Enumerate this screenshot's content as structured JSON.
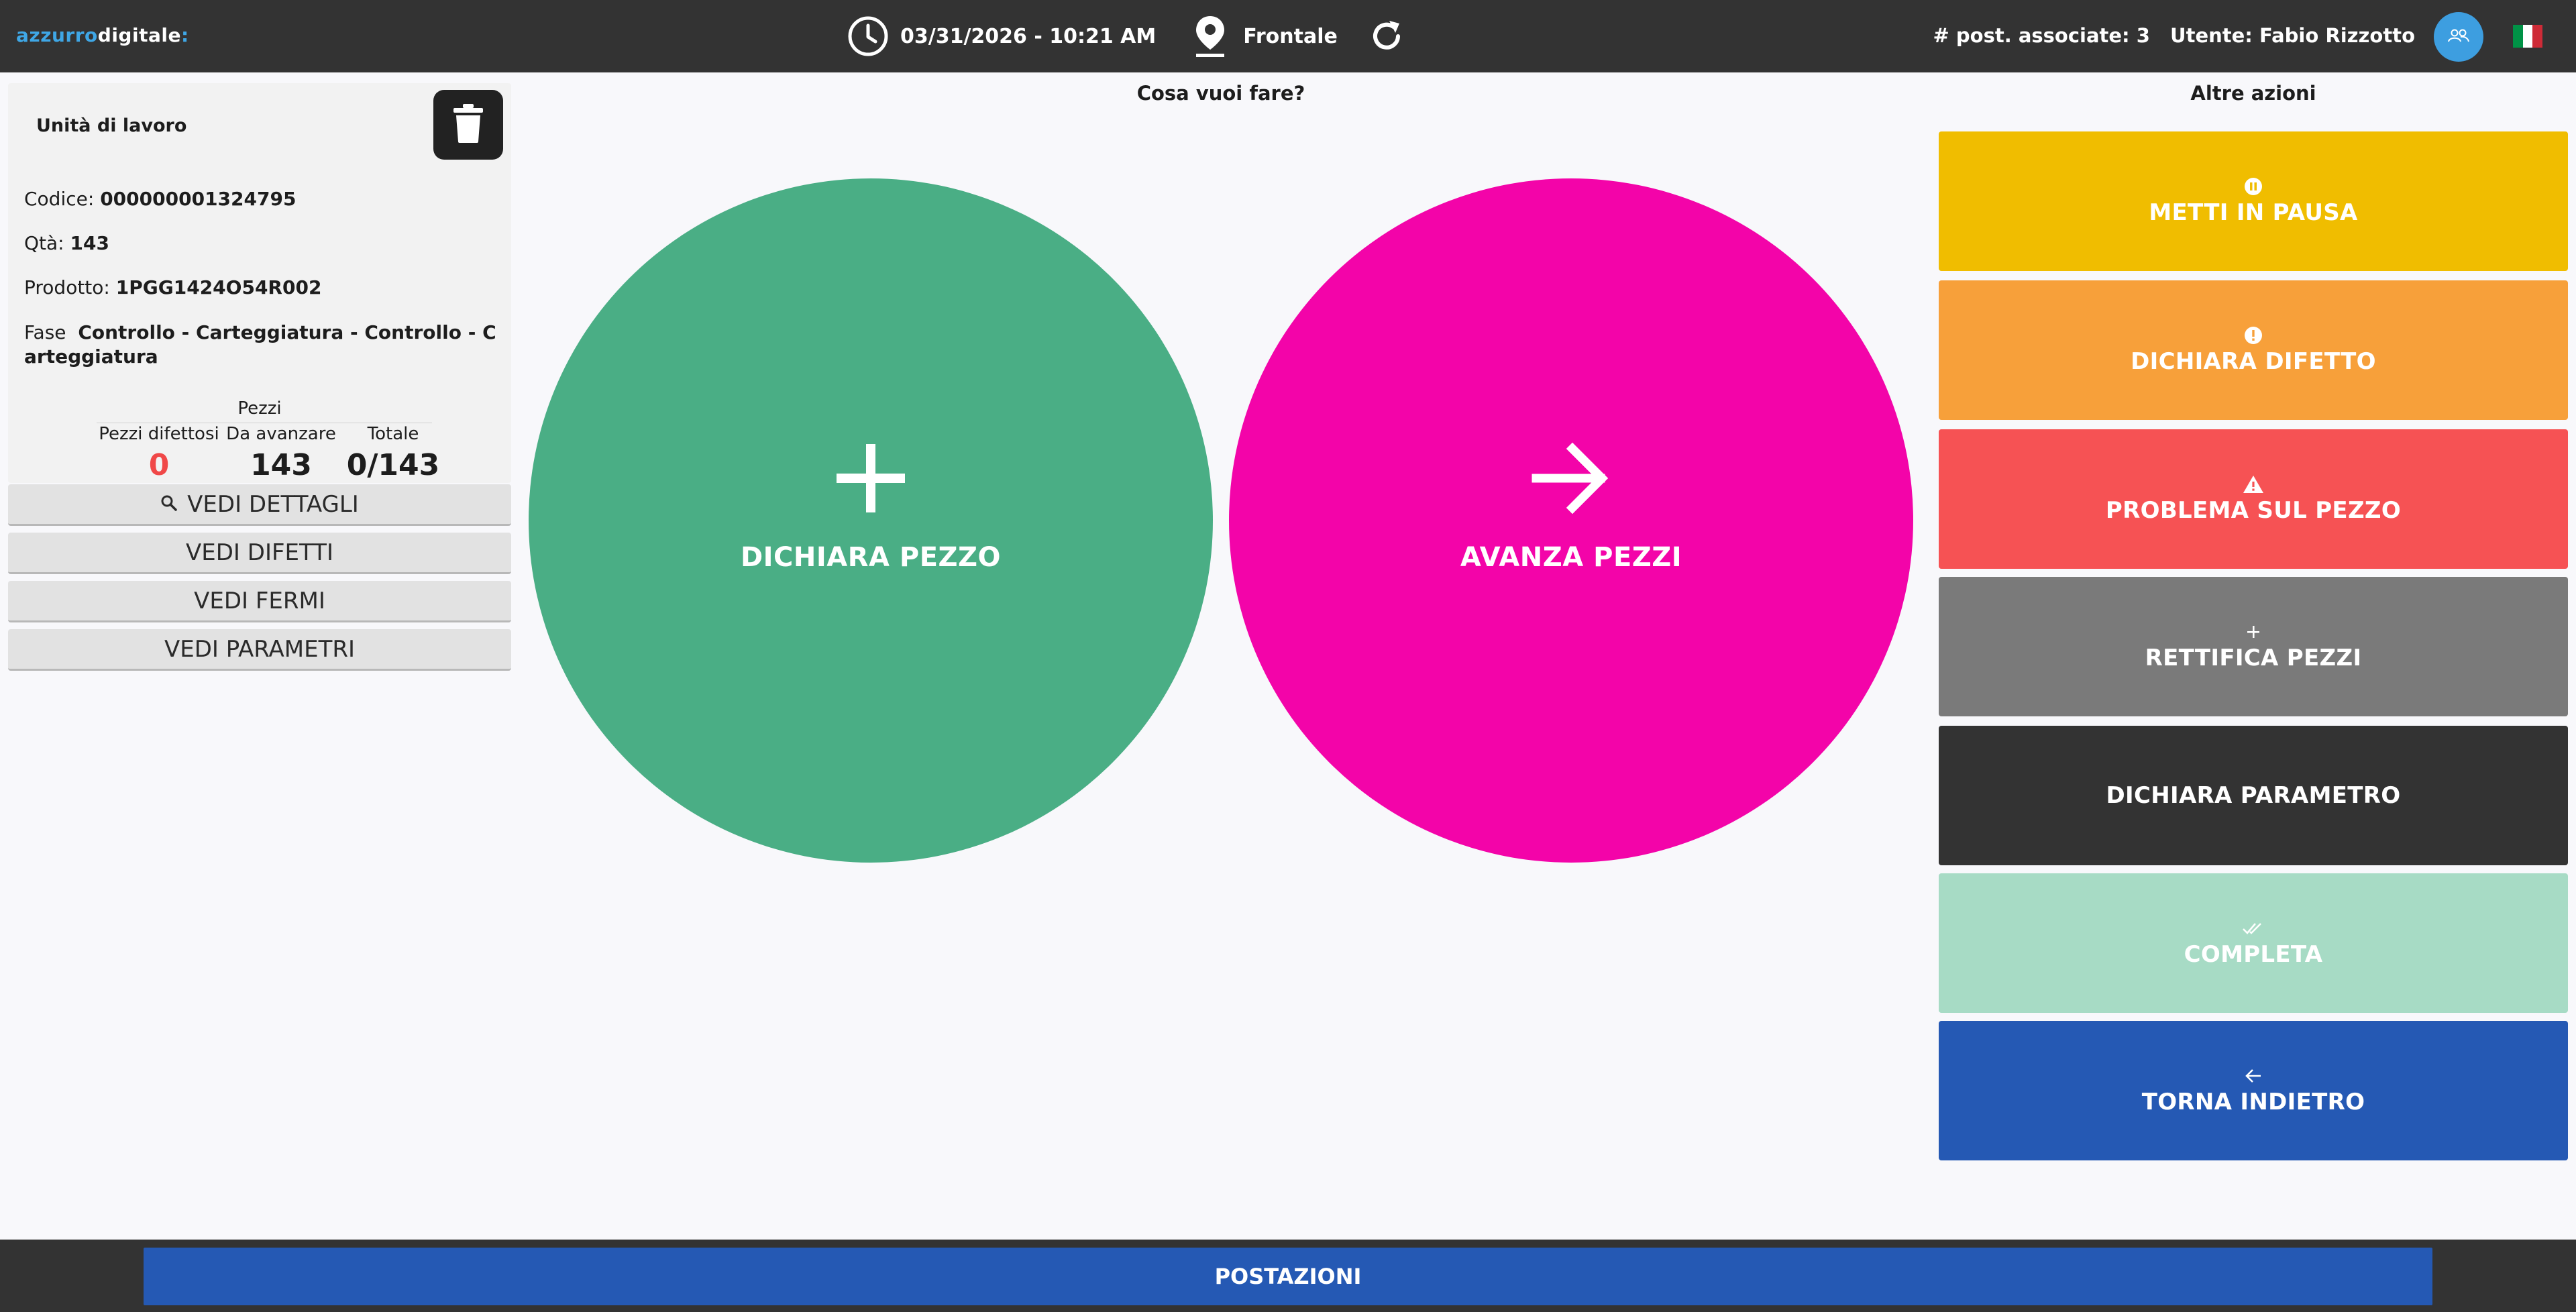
{
  "header": {
    "logo_part1": "azzurro",
    "logo_part2": "digitale",
    "logo_part3": ":",
    "datetime": "03/31/2026 - 10:21 AM",
    "location": "Frontale",
    "associated_positions": "# post. associate: 3",
    "user": "Utente: Fabio Rizzotto",
    "icons": [
      "clock-icon",
      "map-pin-icon",
      "refresh-icon",
      "user-group-icon",
      "italian-flag-icon"
    ],
    "flag_colors": [
      "#009246",
      "#ffffff",
      "#ce2b37"
    ]
  },
  "work_unit": {
    "title": "Unità di lavoro",
    "codice_label": "Codice:",
    "codice_value": "000000001324795",
    "qta_label": "Qtà:",
    "qta_value": "143",
    "prodotto_label": "Prodotto:",
    "prodotto_value": "1PGG1424O54R002",
    "fase_label": "Fase",
    "fase_value": "Controllo - Carteggiatura - Controllo - Carteggiatura",
    "pezzi": {
      "heading": "Pezzi",
      "columns": [
        {
          "label": "Pezzi difettosi",
          "value": "0"
        },
        {
          "label": "Da avanzare",
          "value": "143"
        },
        {
          "label": "Totale",
          "value": "0/143"
        }
      ]
    },
    "buttons": [
      "VEDI DETTAGLI",
      "VEDI DIFETTI",
      "VEDI FERMI",
      "VEDI PARAMETRI"
    ]
  },
  "main": {
    "question": "Cosa vuoi fare?",
    "declare_piece": "DICHIARA PEZZO",
    "advance_pieces": "AVANZA PEZZI"
  },
  "actions": {
    "title": "Altre azioni",
    "items": [
      {
        "label": "METTI IN PAUSA",
        "color": "#f0bd00",
        "icon": "pause-icon"
      },
      {
        "label": "DICHIARA DIFETTO",
        "color": "#f7a03a",
        "icon": "alert-circle-icon"
      },
      {
        "label": "PROBLEMA SUL PEZZO",
        "color": "#f65254",
        "icon": "warning-icon"
      },
      {
        "label": "RETTIFICA PEZZI",
        "color": "#7a7a7a",
        "icon": "plus-icon"
      },
      {
        "label": "DICHIARA PARAMETRO",
        "color": "#333333",
        "icon": ""
      },
      {
        "label": "COMPLETA",
        "color": "#a7dbc5",
        "icon": "double-check-icon"
      },
      {
        "label": "TORNA INDIETRO",
        "color": "#2559b4",
        "icon": "arrow-left-icon"
      }
    ]
  },
  "footer": {
    "postazioni": "POSTAZIONI"
  }
}
